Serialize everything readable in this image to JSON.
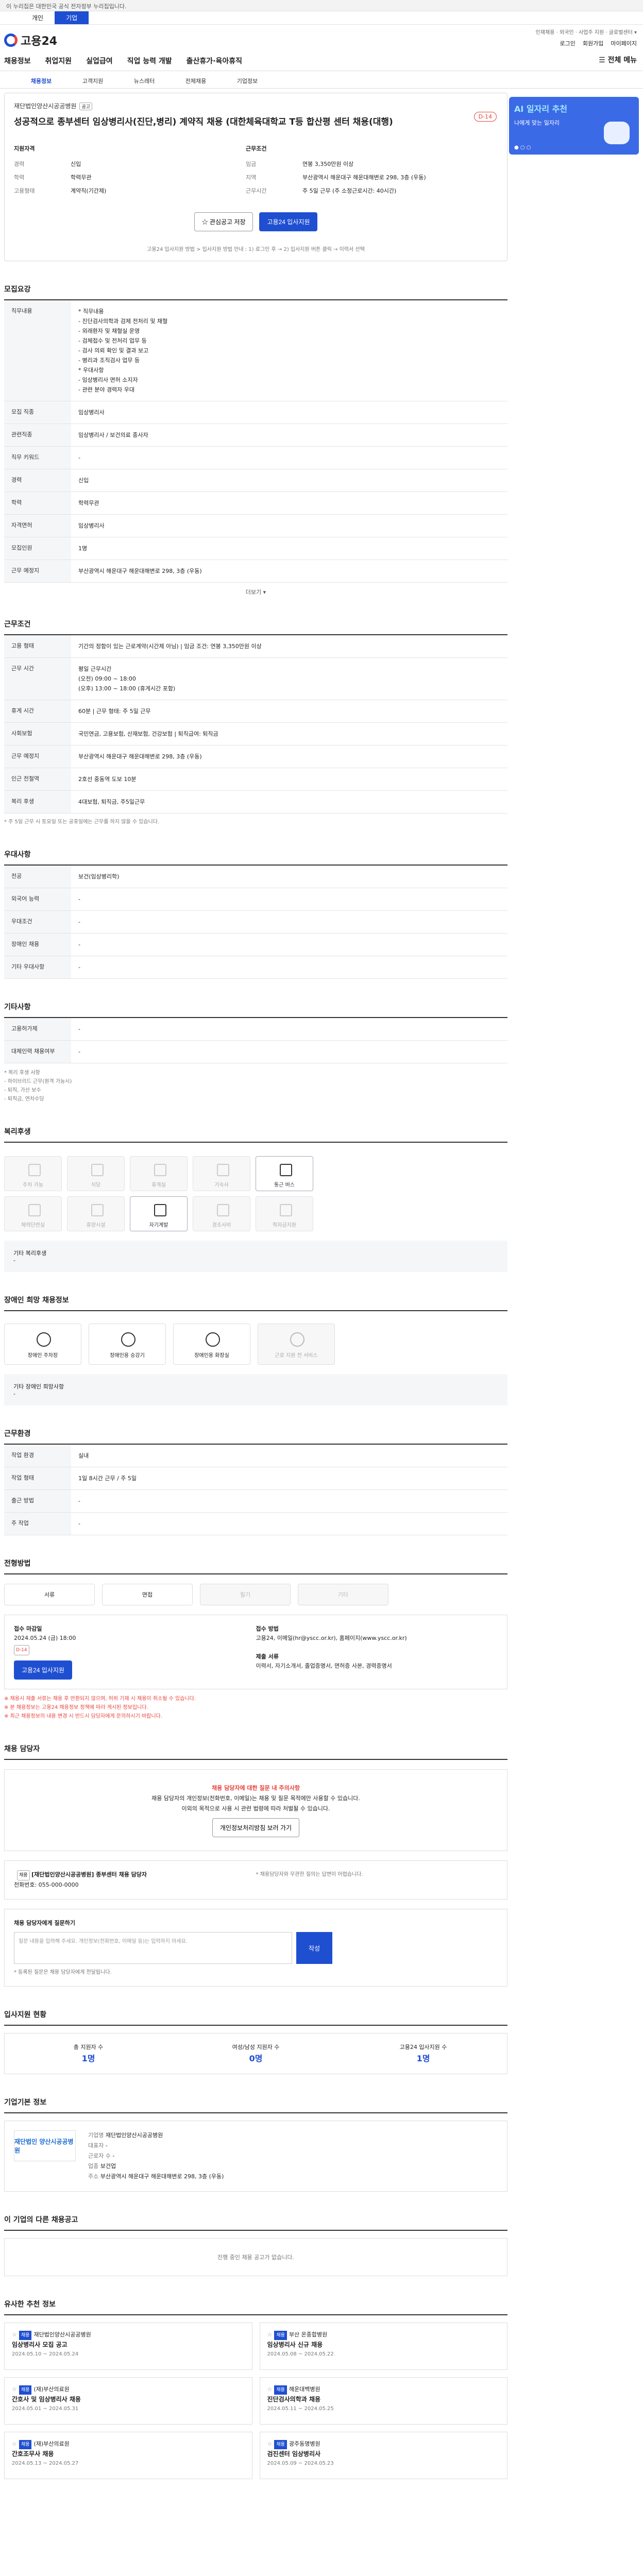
{
  "gov_bar": "이 누리집은 대한민국 공식 전자정부 누리집입니다.",
  "top_tabs": [
    "개인",
    "기업"
  ],
  "logo": "고용24",
  "top_links": "인재채용 · 외국인 · 사업주 지원 · 글로벌센터 ▾",
  "top_icons": [
    "로그인",
    "회원가입",
    "마이페이지"
  ],
  "gnb": [
    "채용정보",
    "취업지원",
    "실업급여",
    "직업 능력 개발",
    "출산휴가·육아휴직"
  ],
  "all_menu": "전체 메뉴",
  "subnav": [
    "채용정보",
    "고객지원",
    "뉴스레터",
    "전체채용",
    "기업정보"
  ],
  "job": {
    "company": "재단법인양산시공공병원",
    "tag": "공고",
    "title": "성공적으로 종부센터 임상병리사(진단,병리) 계약직 채용 (대한체육대학교 T등 합산평 센터 채용(대행)",
    "dday": "D-14",
    "summary_labels": [
      "지원자격",
      "근무조건"
    ],
    "career_l": "경력",
    "career": "신입",
    "edu_l": "학력",
    "edu": "학력무관",
    "wage_l": "임금",
    "wage": "연봉 3,350만원 이상",
    "region_l": "지역",
    "region": "부산광역시 해운대구 해운대해변로 298, 3층 (우동)",
    "type_l": "고용형태",
    "type": "계약직(기간제)",
    "hours_l": "근무시간",
    "hours": "주 5일 근무 (주 소정근로시간: 40시간)",
    "btn_interest": "관심공고 저장",
    "btn_apply": "고용24 입사지원",
    "notice": "고용24 입사지원 방법 > 입사지원 방법 안내 : 1) 로그인 후 → 2) 입사지원 버튼 클릭 → 이력서 선택"
  },
  "sec_job": "모집요강",
  "job_table": [
    [
      "직무내용",
      "* 직무내용\n  - 진단검사의학과 검체 전처리 및 채혈\n    - 외래환자 및 채혈실 운영\n    - 검체접수 및 전처리 업무 등\n    - 검사 의뢰 확인 및 결과 보고\n  - 병리과 조직검사 업무 등\n* 우대사항\n  - 임상병리사 면허 소지자\n  - 관련 분야 경력자 우대"
    ],
    [
      "모집 직종",
      "임상병리사"
    ],
    [
      "관련직종",
      "임상병리사 / 보건의료 종사자"
    ],
    [
      "직무 키워드",
      "-"
    ],
    [
      "경력",
      "신입"
    ],
    [
      "학력",
      "학력무관"
    ],
    [
      "자격면허",
      "임상병리사"
    ],
    [
      "모집인원",
      "1명"
    ],
    [
      "근무 예정지",
      "부산광역시 해운대구 해운대해변로 298, 3층 (우동)"
    ]
  ],
  "more": "더보기 ▾",
  "sec_cond": "근무조건",
  "cond_table": [
    [
      "고용 형태",
      "기간의 정함이 있는 근로계약(시간제 아님)  |  임금 조건: 연봉 3,350만원 이상"
    ],
    [
      "근무 시간",
      "평일 근무시간\n(오전) 09:00 ~ 18:00\n(오후) 13:00 ~ 18:00 (휴게시간 포함)"
    ],
    [
      "휴게 시간",
      "60분  |  근무 형태: 주 5일 근무"
    ],
    [
      "사회보험",
      "국민연금, 고용보험, 산재보험, 건강보험  |  퇴직급여: 퇴직금"
    ],
    [
      "근무 예정지",
      "부산광역시 해운대구 해운대해변로 298, 3층 (우동)"
    ],
    [
      "인근 전철역",
      "2호선 중동역 도보 10분"
    ],
    [
      "복리 후생",
      "4대보험, 퇴직금, 주5일근무"
    ]
  ],
  "cond_note": "* 주 5일 근무 시 토요일 또는 공휴일에는 근무를 하지 않을 수 있습니다.",
  "sec_pref": "우대사항",
  "pref_table": [
    [
      "전공",
      "보건(임상병리학)"
    ],
    [
      "외국어 능력",
      "-"
    ],
    [
      "우대조건",
      "-"
    ],
    [
      "장애인 채용",
      "-"
    ],
    [
      "기타 우대사항",
      "-"
    ]
  ],
  "sec_etc": "기타사항",
  "etc_table": [
    [
      "고용허가제",
      "-"
    ],
    [
      "대체인력 채용여부",
      "-"
    ]
  ],
  "etc_note": "* 복리 후생 사항\n - 하이브리드 근무(원격 가능시)\n - 퇴직, 가산 보수\n - 퇴직금, 연차수당",
  "sec_fac": "복리후생",
  "facilities": [
    "주차 가능",
    "식당",
    "휴게실",
    "기숙사",
    "통근 버스",
    "체력단련실",
    "휴양시설",
    "자기계발",
    "경조사비",
    "학자금지원"
  ],
  "fac_active": [
    "통근 버스",
    "자기계발"
  ],
  "fac_note": "기타 복리후생\n-",
  "sec_disab": "장애인 희망 채용정보",
  "disab_items": [
    "장애인 주차장",
    "장애인용 승강기",
    "장애인용 화장실",
    "근로 지원 전 서비스"
  ],
  "disab_note": "기타 장애인 희망사항\n-",
  "sec_work": "근무환경",
  "work_table": [
    [
      "작업 환경",
      "실내"
    ],
    [
      "작업 형태",
      "1일 8시간 근무 / 주 5일"
    ],
    [
      "출근 방법",
      "-"
    ],
    [
      "주 작업",
      "-"
    ]
  ],
  "sec_apply": "전형방법",
  "screen_steps": [
    "서류",
    "면접",
    "필기",
    "기타"
  ],
  "apply": {
    "deadline_l": "접수 마감일",
    "deadline": "2024.05.24 (금) 18:00",
    "dday": "D-14",
    "btn": "고용24 입사지원",
    "method_l": "접수 방법",
    "method": "고용24, 이메일(hr@yscc.or.kr), 홈페이지(www.yscc.or.kr)",
    "docs_l": "제출 서류",
    "docs": "이력서, 자기소개서, 졸업증명서, 면허증 사본, 경력증명서"
  },
  "apply_notes": "※ 채용시 제출 서류는 채용 후 반환되지 않으며, 허위 기재 시 채용이 취소될 수 있습니다.\n※ 본 채용정보는 고용24 채용정보 정책에 따라 게시된 정보입니다.\n※ 최근 채용정보의 내용 변경 시 반드시 담당자에게 문의하시기 바랍니다.",
  "sec_contact": "채용 담당자",
  "chat": {
    "title": "채용 담당자에 대한 질문 내 주의사항",
    "line1": "채용 담당자의 개인정보(전화번호, 이메일)는 채용 및 질문 목적에만 사용할 수 있습니다.",
    "line2": "이외의 목적으로 사용 시 관련 법령에 따라 처벌될 수 있습니다.",
    "btn": "개인정보처리방침 보러 가기"
  },
  "contact": {
    "badge": "채용",
    "name": "[재단법인양산시공공병원] 종부센터 채용 담당자",
    "phone": "전화번호: 055-000-0000",
    "note": "* 채용담당자와 무관한 질의는 답변이 어렵습니다."
  },
  "qa": {
    "title": "채용 담당자에게 질문하기",
    "placeholder": "질문 내용을 입력해 주세요. 개인정보(전화번호, 이메일 등)는 입력하지 마세요.",
    "btn": "작성",
    "note": "* 등록된 질문은 채용 담당자에게 전달됩니다."
  },
  "sec_stats": "입사지원 현황",
  "stats": [
    [
      "총 지원자 수",
      "1명"
    ],
    [
      "여성/남성 지원자 수",
      "0명"
    ],
    [
      "고용24 입사지원 수",
      "1명"
    ]
  ],
  "stats_more": "더보기 >",
  "sec_comp": "기업기본 정보",
  "comp": {
    "logo": "재단법인 양산시공공병원",
    "name_l": "기업명",
    "name": "재단법인양산시공공병원",
    "ceo_l": "대표자",
    "ceo": "-",
    "emp_l": "근로자 수",
    "emp": "-",
    "industry_l": "업종",
    "industry": "보건업",
    "addr_l": "주소",
    "addr": "부산광역시 해운대구 해운대해변로 298, 3층 (우동)"
  },
  "sec_similar": "이 기업의 다른 채용공고",
  "similar_empty": "진행 중인 채용 공고가 없습니다.",
  "sec_related": "유사한 추천 정보",
  "related": [
    [
      "채용",
      "재단법인양산시공공병원",
      "임상병리사 모집 공고",
      "2024.05.10 ~ 2024.05.24"
    ],
    [
      "채용",
      "부산 온종합병원",
      "임상병리사 신규 채용",
      "2024.05.08 ~ 2024.05.22"
    ],
    [
      "채용",
      "(재)부산의료원",
      "간호사 및 임상병리사 채용",
      "2024.05.01 ~ 2024.05.31"
    ],
    [
      "채용",
      "해운대백병원",
      "진단검사의학과 채용",
      "2024.05.11 ~ 2024.05.25"
    ],
    [
      "채용",
      "(재)부산의료원",
      "간호조무사 채용",
      "2024.05.13 ~ 2024.05.27"
    ],
    [
      "채용",
      "광주동명병원",
      "검진센터 임상병리사",
      "2024.05.09 ~ 2024.05.23"
    ]
  ]
}
